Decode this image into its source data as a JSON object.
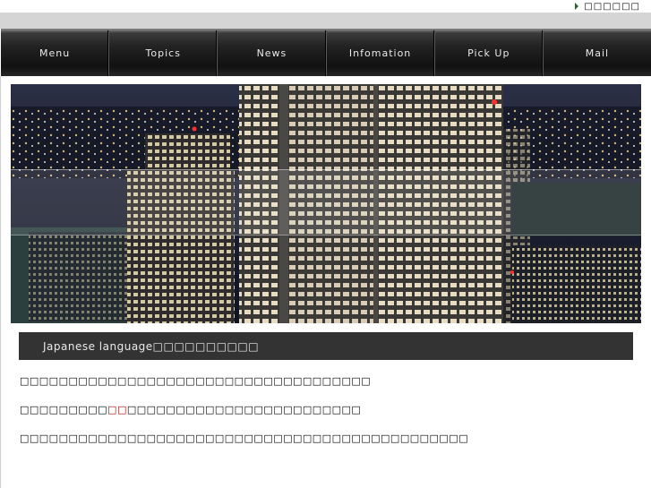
{
  "top_link": {
    "label": "□□□□□□"
  },
  "nav": {
    "items": [
      "Menu",
      "Topics",
      "News",
      "Infomation",
      "Pick Up",
      "Mail"
    ]
  },
  "hero": {
    "image_name": "city-night-skyline"
  },
  "section": {
    "title": "Japanese language□□□□□□□□□□"
  },
  "content": {
    "p1": "□□□□□□□□□□□□□□□□□□□□□□□□□□□□□□□□□□□□",
    "p2_pre": "□□□□□□□□□",
    "p2_hl": "□□",
    "p2_post": "□□□□□□□□□□□□□□□□□□□□□□□□",
    "p3": "□□□□□□□□□□□□□□□□□□□□□□□□□□□□□□□□□□□□□□□□□□□□□□"
  },
  "colors": {
    "highlight": "#b00000",
    "nav_dark": "#1a1a1a",
    "title_bar": "#333333"
  }
}
